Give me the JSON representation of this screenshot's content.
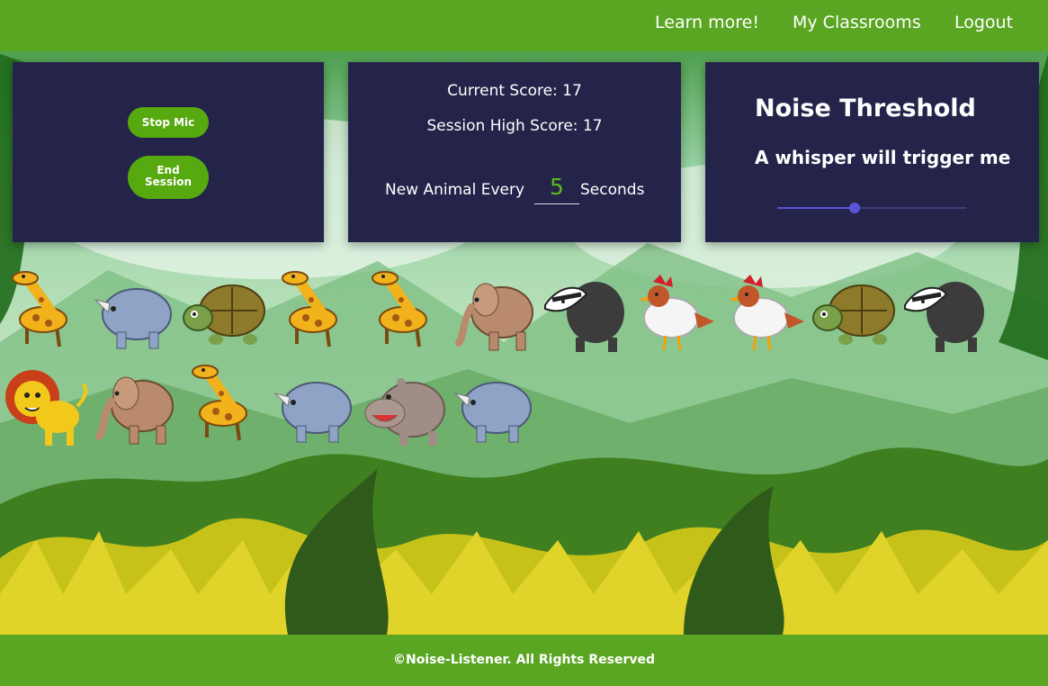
{
  "nav": {
    "learn_more": "Learn more!",
    "my_classrooms": "My Classrooms",
    "logout": "Logout"
  },
  "controls": {
    "stop_mic": "Stop Mic",
    "end_session_line1": "End",
    "end_session_line2": "Session"
  },
  "score": {
    "current": "Current Score: 17",
    "high": "Session High Score: 17",
    "interval_prefix": "New Animal Every",
    "interval_value": "5",
    "interval_suffix": "Seconds"
  },
  "threshold": {
    "title": "Noise Threshold",
    "description": "A whisper will trigger me",
    "slider_level": 0.41
  },
  "animals": [
    "giraffe",
    "rhino",
    "tortoise",
    "giraffe",
    "giraffe",
    "elephant",
    "badger",
    "rooster",
    "rooster",
    "tortoise",
    "badger",
    "lion",
    "elephant",
    "giraffe",
    "rhino",
    "hippo",
    "rhino"
  ],
  "footer": {
    "copyright": "©Noise-Listener. All Rights Reserved"
  },
  "colors": {
    "nav": "#5aa522",
    "panel": "#24244a",
    "button": "#56a90f",
    "accent": "#5a55d8",
    "value": "#5ab81a"
  }
}
